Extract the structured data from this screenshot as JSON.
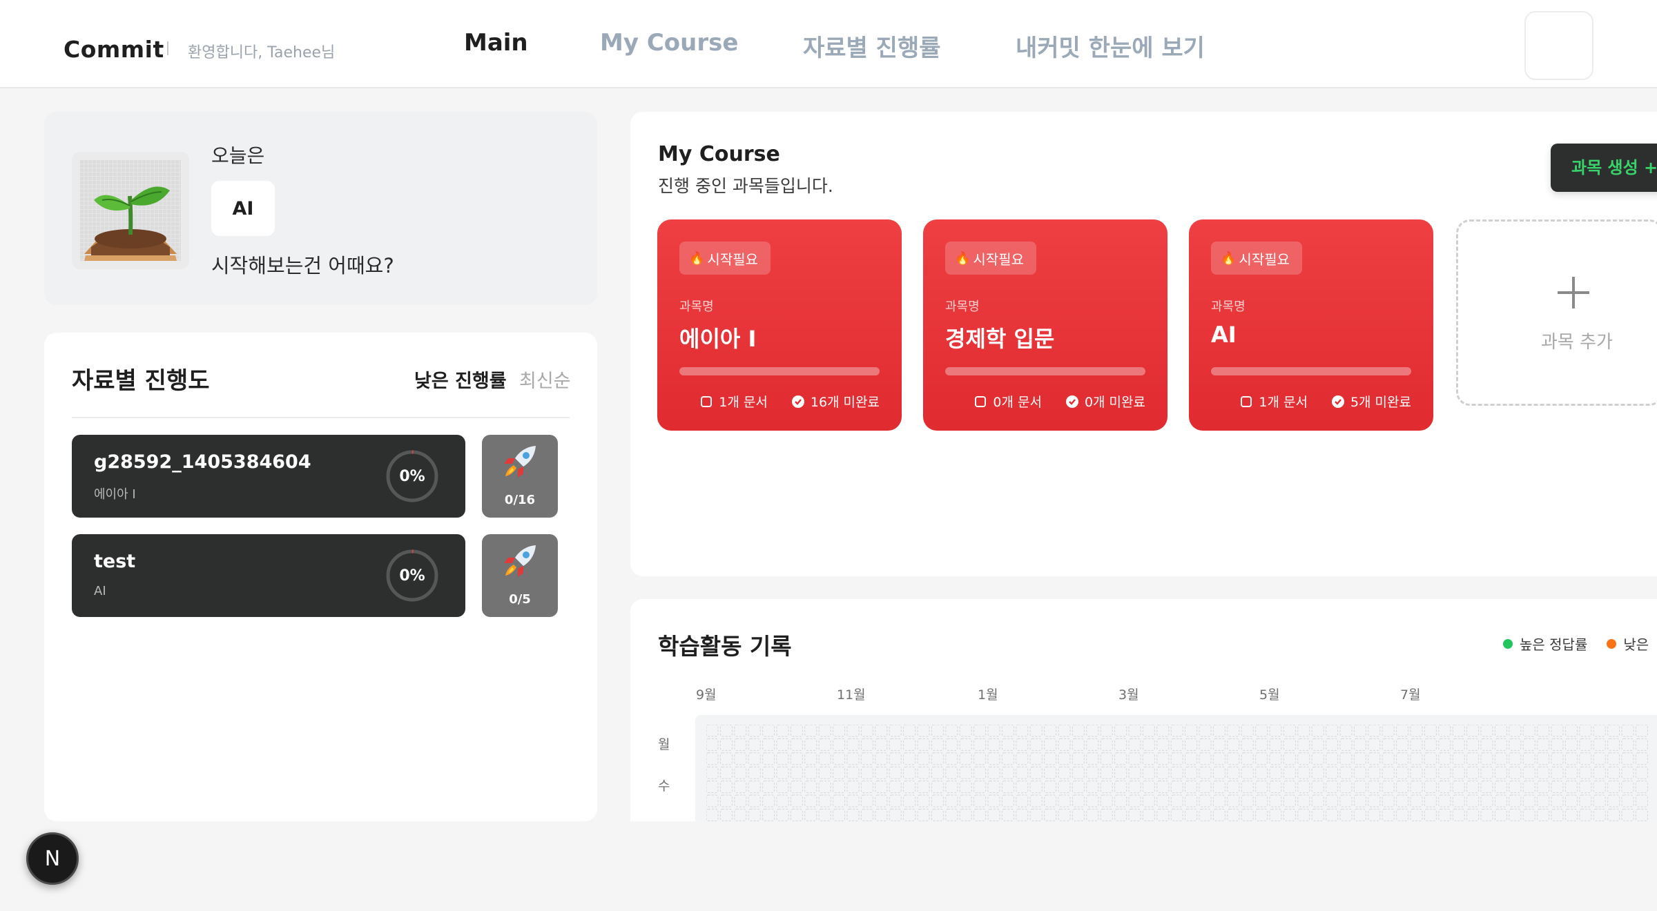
{
  "header": {
    "brand": "Commit",
    "welcome": "환영합니다, Taehee님",
    "nav": [
      {
        "label": "Main",
        "active": true
      },
      {
        "label": "My Course",
        "active": false
      },
      {
        "label": "자료별 진행률",
        "active": false
      },
      {
        "label": "내커밋 한눈에 보기",
        "active": false
      }
    ]
  },
  "today": {
    "label": "오늘은",
    "chip": "AI",
    "subtitle": "시작해보는건 어때요?",
    "image_icon": "sprout-icon"
  },
  "progress": {
    "title": "자료별 진행도",
    "sort_low": "낮은 진행률",
    "sort_new": "최신순",
    "items": [
      {
        "name": "g28592_1405384604",
        "course": "에이아 I",
        "percent": "0%",
        "count": "0/16",
        "progress": 0
      },
      {
        "name": "test",
        "course": "AI",
        "percent": "0%",
        "count": "0/5",
        "progress": 0
      }
    ]
  },
  "my_course": {
    "title": "My Course",
    "subtitle": "진행 중인 과목들입니다.",
    "create_label": "과목 생성 +",
    "add_label": "과목 추가",
    "cards": [
      {
        "badge": "시작필요",
        "label": "과목명",
        "name": "에이아 I",
        "docs": "1개 문서",
        "incomplete": "16개 미완료",
        "progress": 0
      },
      {
        "badge": "시작필요",
        "label": "과목명",
        "name": "경제학 입문",
        "docs": "0개 문서",
        "incomplete": "0개 미완료",
        "progress": 0
      },
      {
        "badge": "시작필요",
        "label": "과목명",
        "name": "AI",
        "docs": "1개 문서",
        "incomplete": "5개 미완료",
        "progress": 0
      }
    ]
  },
  "activity": {
    "title": "학습활동 기록",
    "legend": [
      {
        "label": "높은 정답률",
        "color": "#22c55e"
      },
      {
        "label": "낮은",
        "color": "#f97316"
      }
    ],
    "months": [
      "9월",
      "11월",
      "1월",
      "3월",
      "5월",
      "7월"
    ],
    "days": [
      "월",
      "수"
    ]
  },
  "fab": {
    "label": "N"
  },
  "colors": {
    "accent_red": "#e3312f",
    "dark_card": "#2d2f2e",
    "create_text": "#39d36b"
  }
}
